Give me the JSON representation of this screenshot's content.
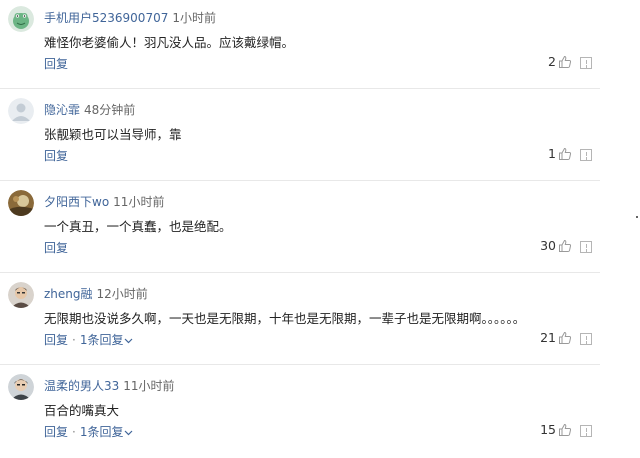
{
  "comments": [
    {
      "username": "手机用户5236900707",
      "time": "1小时前",
      "text": "难怪你老婆偷人！羽凡没人品。应该戴绿帽。",
      "reply_label": "回复",
      "likes": "2",
      "avatar_icon": "frog-avatar-icon"
    },
    {
      "username": "隐沁霏",
      "time": "48分钟前",
      "text": "张靓颖也可以当导师，靠",
      "reply_label": "回复",
      "likes": "1",
      "avatar_icon": "default-avatar-icon"
    },
    {
      "username": "夕阳西下wo",
      "time": "11小时前",
      "text": "一个真丑，一个真蠢，也是绝配。",
      "reply_label": "回复",
      "likes": "30",
      "avatar_icon": "photo-avatar-icon"
    },
    {
      "username": "zheng融",
      "time": "12小时前",
      "text": "无限期也没说多久啊，一天也是无限期，十年也是无限期，一辈子也是无限期啊。。。。。。",
      "reply_label": "回复",
      "replies_label": "1条回复",
      "likes": "21",
      "avatar_icon": "person-avatar-icon"
    },
    {
      "username": "温柔的男人33",
      "time": "11小时前",
      "text": "百合的嘴真大",
      "reply_label": "回复",
      "replies_label": "1条回复",
      "likes": "15",
      "avatar_icon": "person-avatar-icon"
    }
  ],
  "colors": {
    "link": "#406599",
    "divider": "#e8e8e8"
  }
}
